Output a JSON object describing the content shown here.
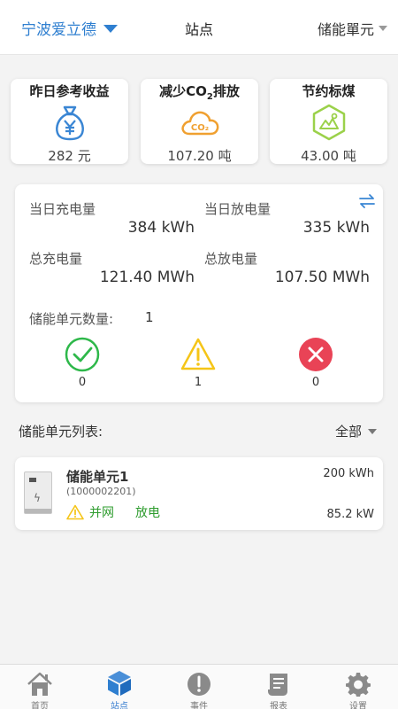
{
  "header": {
    "company": "宁波爱立德",
    "title": "站点",
    "unit_selector": "储能單元"
  },
  "stats": [
    {
      "title": "昨日参考收益",
      "value": "282 元",
      "icon": "money-bag-icon",
      "color": "#3a86d4"
    },
    {
      "title_prefix": "减少CO",
      "title_sub": "2",
      "title_suffix": "排放",
      "value": "107.20 吨",
      "icon": "co2-cloud-icon",
      "color": "#f0a030"
    },
    {
      "title": "节约标煤",
      "value": "43.00 吨",
      "icon": "coal-hexagon-icon",
      "color": "#9bd14a"
    }
  ],
  "summary": {
    "day_charge_label": "当日充电量",
    "day_charge_value": "384 kWh",
    "day_discharge_label": "当日放电量",
    "day_discharge_value": "335 kWh",
    "total_charge_label": "总充电量",
    "total_charge_value": "121.40 MWh",
    "total_discharge_label": "总放电量",
    "total_discharge_value": "107.50 MWh",
    "unit_count_label": "储能单元数量:",
    "unit_count_value": "1",
    "status": {
      "normal_count": "0",
      "warning_count": "1",
      "fault_count": "0"
    }
  },
  "list": {
    "title": "储能单元列表:",
    "filter": "全部",
    "items": [
      {
        "name": "储能单元1",
        "id": "(1000002201)",
        "grid_status": "并网",
        "mode": "放电",
        "capacity": "200 kWh",
        "power": "85.2 kW"
      }
    ]
  },
  "nav": {
    "items": [
      {
        "label": "首页",
        "icon": "home-icon"
      },
      {
        "label": "站点",
        "icon": "cube-icon"
      },
      {
        "label": "事件",
        "icon": "alert-icon"
      },
      {
        "label": "报表",
        "icon": "report-icon"
      },
      {
        "label": "设置",
        "icon": "gear-icon"
      }
    ]
  },
  "colors": {
    "accent": "#2f7fd0",
    "success": "#2eb84a",
    "warning": "#f5c518",
    "danger": "#e94356"
  }
}
